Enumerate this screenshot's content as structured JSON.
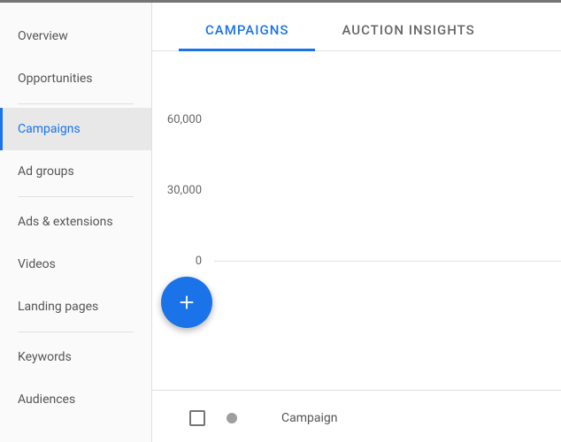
{
  "sidebar": {
    "groups": [
      [
        {
          "label": "Overview",
          "active": false
        },
        {
          "label": "Opportunities",
          "active": false
        }
      ],
      [
        {
          "label": "Campaigns",
          "active": true
        },
        {
          "label": "Ad groups",
          "active": false
        }
      ],
      [
        {
          "label": "Ads & extensions",
          "active": false
        },
        {
          "label": "Videos",
          "active": false
        },
        {
          "label": "Landing pages",
          "active": false
        }
      ],
      [
        {
          "label": "Keywords",
          "active": false
        },
        {
          "label": "Audiences",
          "active": false
        }
      ]
    ]
  },
  "tabs": [
    {
      "label": "CAMPAIGNS",
      "active": true
    },
    {
      "label": "AUCTION INSIGHTS",
      "active": false
    }
  ],
  "table": {
    "columns": [
      {
        "label": "Campaign"
      }
    ]
  },
  "fab": {
    "label": "+"
  },
  "chart_data": {
    "type": "line",
    "title": "",
    "xlabel": "",
    "ylabel": "",
    "ylim": [
      0,
      60000
    ],
    "yticks": [
      0,
      30000,
      60000
    ],
    "ytick_labels": [
      "0",
      "30,000",
      "60,000"
    ],
    "series": [],
    "categories": []
  }
}
